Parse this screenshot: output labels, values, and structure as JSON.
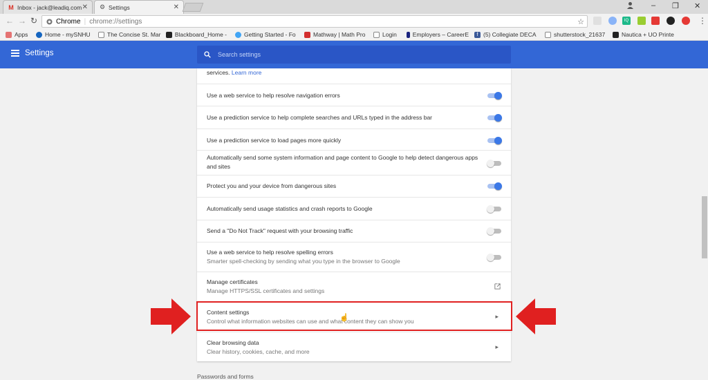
{
  "browser": {
    "tabs": [
      {
        "title": "Inbox - jack@leadiq.com"
      },
      {
        "title": "Settings"
      }
    ],
    "omnibox": {
      "site": "Chrome",
      "url": "chrome://settings"
    },
    "bookmarks": [
      "Apps",
      "Home - mySNHU",
      "The Concise St. Mar",
      "Blackboard_Home -",
      "Getting Started - Fo",
      "Mathway | Math Pro",
      "Login",
      "Employers – CareerE",
      "(5) Collegiate DECA",
      "shutterstock_21637",
      "Nautica + UO Printe"
    ],
    "extension_badges": [
      "IQ"
    ]
  },
  "header": {
    "title": "Settings",
    "search_placeholder": "Search settings"
  },
  "settings": {
    "top_text": "services.",
    "learn_more": "Learn more",
    "rows": [
      {
        "label": "Use a web service to help resolve navigation errors",
        "state": "on"
      },
      {
        "label": "Use a prediction service to help complete searches and URLs typed in the address bar",
        "state": "on"
      },
      {
        "label": "Use a prediction service to load pages more quickly",
        "state": "on"
      },
      {
        "label": "Automatically send some system information and page content to Google to help detect dangerous apps and sites",
        "state": "off"
      },
      {
        "label": "Protect you and your device from dangerous sites",
        "state": "on"
      },
      {
        "label": "Automatically send usage statistics and crash reports to Google",
        "state": "off"
      },
      {
        "label": "Send a \"Do Not Track\" request with your browsing traffic",
        "state": "off"
      },
      {
        "label": "Use a web service to help resolve spelling errors",
        "sub": "Smarter spell-checking by sending what you type in the browser to Google",
        "state": "off"
      }
    ],
    "manage_certificates": {
      "label": "Manage certificates",
      "sub": "Manage HTTPS/SSL certificates and settings"
    },
    "content_settings": {
      "label": "Content settings",
      "sub": "Control what information websites can use and what content they can show you"
    },
    "clear_browsing": {
      "label": "Clear browsing data",
      "sub": "Clear history, cookies, cache, and more"
    },
    "next_section": "Passwords and forms"
  },
  "colors": {
    "accent": "#3367d6",
    "highlight": "#e02020",
    "toggle_on": "#3b78e7"
  }
}
